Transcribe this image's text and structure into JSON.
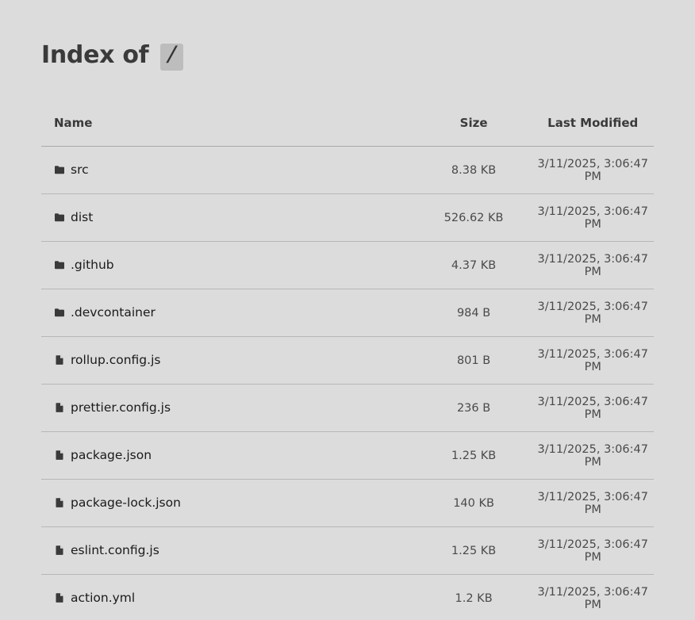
{
  "header": {
    "title_prefix": "Index of",
    "path": "/"
  },
  "table": {
    "columns": {
      "name": "Name",
      "size": "Size",
      "modified": "Last Modified"
    },
    "rows": [
      {
        "name": "src",
        "type": "folder",
        "icon": "folder-icon",
        "size": "8.38 KB",
        "modified": "3/11/2025, 3:06:47 PM"
      },
      {
        "name": "dist",
        "type": "folder",
        "icon": "folder-icon",
        "size": "526.62 KB",
        "modified": "3/11/2025, 3:06:47 PM"
      },
      {
        "name": ".github",
        "type": "folder",
        "icon": "folder-icon",
        "size": "4.37 KB",
        "modified": "3/11/2025, 3:06:47 PM"
      },
      {
        "name": ".devcontainer",
        "type": "folder",
        "icon": "folder-icon",
        "size": "984 B",
        "modified": "3/11/2025, 3:06:47 PM"
      },
      {
        "name": "rollup.config.js",
        "type": "file",
        "icon": "file-icon",
        "size": "801 B",
        "modified": "3/11/2025, 3:06:47 PM"
      },
      {
        "name": "prettier.config.js",
        "type": "file",
        "icon": "file-icon",
        "size": "236 B",
        "modified": "3/11/2025, 3:06:47 PM"
      },
      {
        "name": "package.json",
        "type": "file",
        "icon": "file-icon",
        "size": "1.25 KB",
        "modified": "3/11/2025, 3:06:47 PM"
      },
      {
        "name": "package-lock.json",
        "type": "file",
        "icon": "file-icon",
        "size": "140 KB",
        "modified": "3/11/2025, 3:06:47 PM"
      },
      {
        "name": "eslint.config.js",
        "type": "file",
        "icon": "file-icon",
        "size": "1.25 KB",
        "modified": "3/11/2025, 3:06:47 PM"
      },
      {
        "name": "action.yml",
        "type": "file",
        "icon": "file-icon",
        "size": "1.2 KB",
        "modified": "3/11/2025, 3:06:47 PM"
      }
    ]
  }
}
